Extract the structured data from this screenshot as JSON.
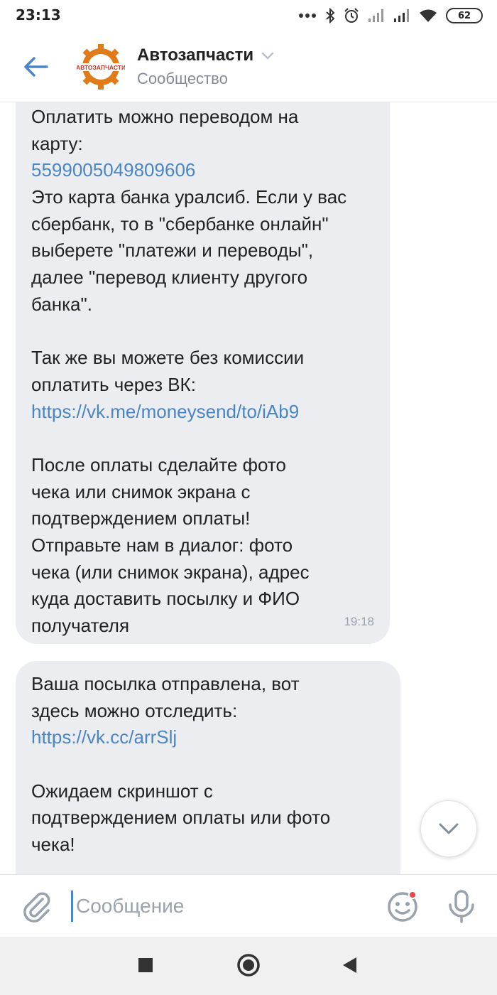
{
  "status_bar": {
    "time": "23:13",
    "battery": "62"
  },
  "header": {
    "title": "Автозапчасти",
    "subtitle": "Сообщество",
    "avatar_text": "АВТОЗАПЧАСТИ",
    "accent_color": "#4a86c5"
  },
  "messages": [
    {
      "lines": [
        {
          "text": "Оплатить можно переводом на",
          "type": "text"
        },
        {
          "text": "карту:",
          "type": "text"
        },
        {
          "text": "5599005049809606",
          "type": "link"
        },
        {
          "text": "Это карта банка уралсиб. Если у вас",
          "type": "text"
        },
        {
          "text": "сбербанк, то в \"сбербанке онлайн\"",
          "type": "text"
        },
        {
          "text": "выберете \"платежи и переводы\",",
          "type": "text"
        },
        {
          "text": "далее \"перевод клиенту другого",
          "type": "text"
        },
        {
          "text": "банка\".",
          "type": "text"
        },
        {
          "text": "",
          "type": "blank"
        },
        {
          "text": "Так же вы можете без комиссии",
          "type": "text"
        },
        {
          "text": "оплатить через ВК:",
          "type": "text"
        },
        {
          "text": "https://vk.me/moneysend/to/iAb9",
          "type": "link"
        },
        {
          "text": "",
          "type": "blank"
        },
        {
          "text": "После оплаты сделайте фото",
          "type": "text"
        },
        {
          "text": "чека или снимок экрана с",
          "type": "text"
        },
        {
          "text": "подтверждением оплаты!",
          "type": "text"
        },
        {
          "text": "Отправьте нам в диалог: фото",
          "type": "text"
        },
        {
          "text": "чека (или снимок экрана), адрес",
          "type": "text"
        },
        {
          "text": "куда доставить посылку и ФИО",
          "type": "text"
        },
        {
          "text": "получателя",
          "type": "text"
        }
      ],
      "time": "19:18"
    },
    {
      "lines": [
        {
          "text": "Ваша посылка отправлена, вот",
          "type": "text"
        },
        {
          "text": "здесь можно отследить:",
          "type": "text"
        },
        {
          "text": "https://vk.cc/arrSlj",
          "type": "link"
        },
        {
          "text": "",
          "type": "blank"
        },
        {
          "text": "Ожидаем скриншот с",
          "type": "text"
        },
        {
          "text": "подтверждением оплаты или фото",
          "type": "text"
        },
        {
          "text": "чека!",
          "type": "text"
        }
      ]
    }
  ],
  "composer": {
    "placeholder": "Сообщение"
  },
  "icons": {
    "back": "arrow-left-icon",
    "scroll_down": "chevron-down-icon",
    "attach": "paperclip-icon",
    "emoji": "smile-icon",
    "mic": "microphone-icon"
  }
}
